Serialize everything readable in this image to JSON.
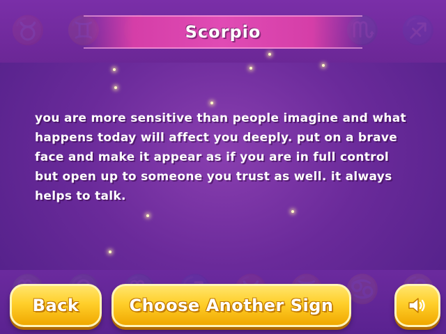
{
  "header": {
    "title": "Scorpio"
  },
  "reading": {
    "text": "You are more sensitive than people imagine and what happens today will affect you deeply. Put on a brave face and make it appear as if you are in full control but open up to someone you trust as well. It always helps to talk."
  },
  "buttons": {
    "back_label": "Back",
    "choose_label": "Choose Another Sign",
    "sound_icon": "speaker-icon"
  },
  "background": {
    "zodiac_glyphs": [
      "♉",
      "♊",
      "♋",
      "♌",
      "♍",
      "♎",
      "♏",
      "♐"
    ]
  },
  "colors": {
    "background": "#6a2a9a",
    "title_bar": "#e04bb4",
    "button": "#ffcf2a"
  }
}
